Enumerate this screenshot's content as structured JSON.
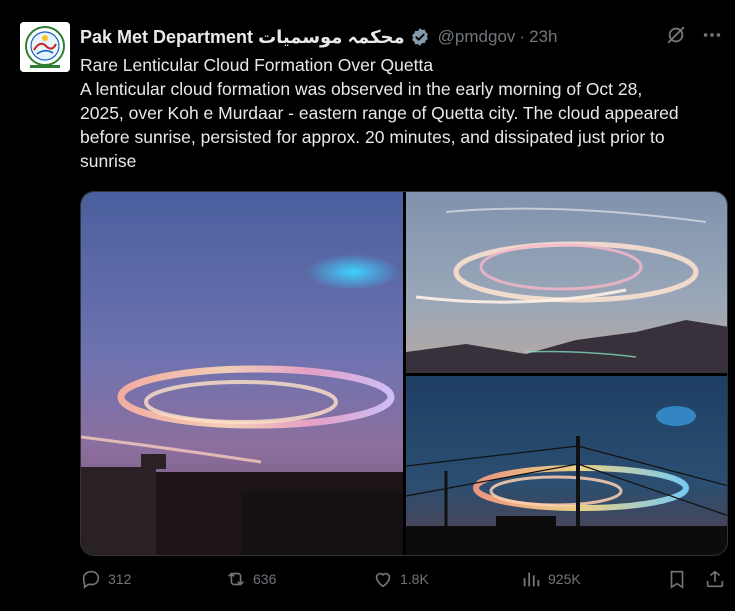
{
  "tweet": {
    "name": "Pak Met Department محکمہ موسمیات",
    "handle": "@pmdgov",
    "separator": "·",
    "time": "23h",
    "text_lines": [
      "Rare Lenticular Cloud Formation Over Quetta",
      "A lenticular cloud formation was observed in the early morning of Oct 28,",
      "2025, over Koh e Murdaar - eastern range of Quetta city. The cloud appeared",
      "before sunrise, persisted for approx. 20 minutes, and dissipated just prior to",
      "sunrise"
    ]
  },
  "actions": {
    "replies": "312",
    "reposts": "636",
    "likes": "1.8K",
    "views": "925K"
  },
  "icons": {
    "verified": "verified-badge-icon",
    "grok": "grok-icon",
    "more": "more-icon",
    "reply": "reply-icon",
    "repost": "repost-icon",
    "like": "like-icon",
    "views": "views-icon",
    "bookmark": "bookmark-icon",
    "share": "share-icon"
  },
  "colors": {
    "background": "#000000",
    "text": "#e7e9ea",
    "muted": "#71767b",
    "verified": "#829aab"
  }
}
